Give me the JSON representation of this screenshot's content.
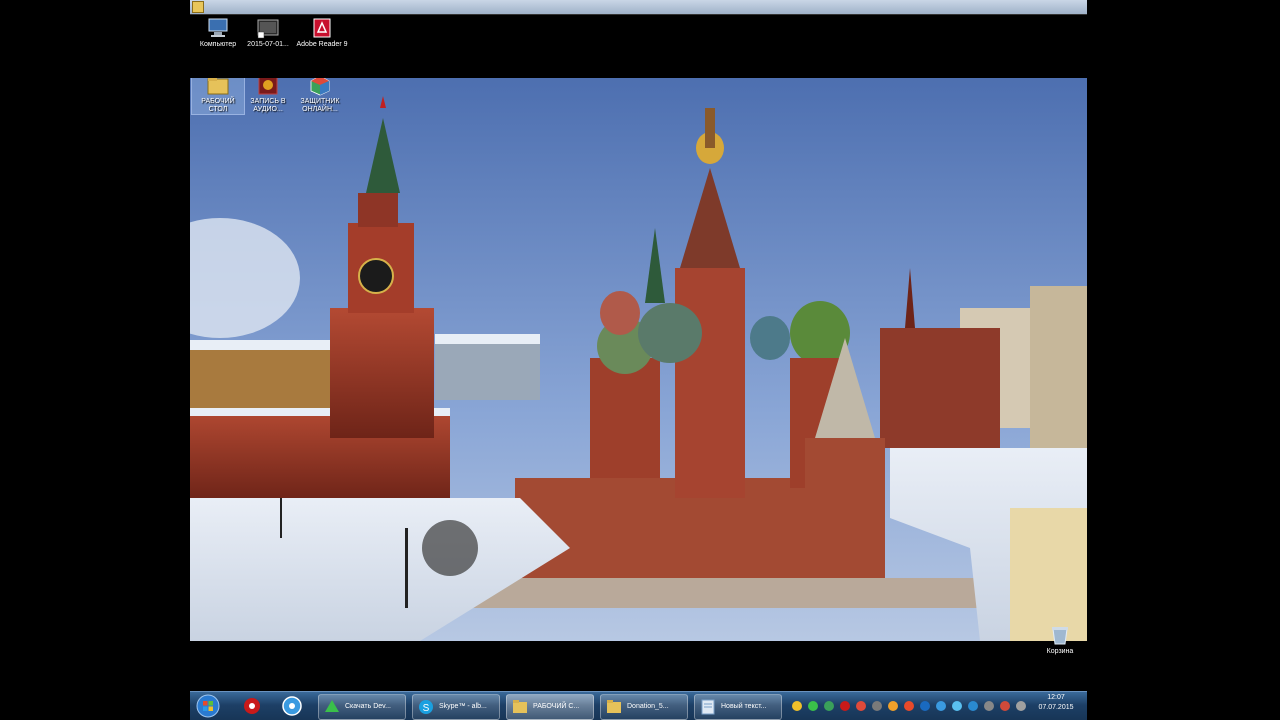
{
  "colors": {
    "taskbar": "#1d3f66",
    "sky": "#6f8fc4"
  },
  "top_icons": [
    {
      "icon": "computer-icon",
      "label": "Компьютер"
    },
    {
      "icon": "shortcut-icon",
      "label": "2015-07-01..."
    },
    {
      "icon": "adobe-reader-icon",
      "label": "Adobe Reader 9"
    }
  ],
  "desk_icons": [
    {
      "icon": "folder-icon",
      "label": "РАБОЧИЙ СТОЛ"
    },
    {
      "icon": "app-shortcut-icon",
      "label": "ЗАПИСЬ В АУДИО..."
    },
    {
      "icon": "cube-app-icon",
      "label": "ЗАЩИТНИК ОНЛАЙН..."
    }
  ],
  "recycle_label": "Корзина",
  "taskbar": {
    "buttons": [
      {
        "icon": "download-icon",
        "label": "Скачать Dev..."
      },
      {
        "icon": "skype-icon",
        "label": "Skype™ - alb..."
      },
      {
        "icon": "folder-icon",
        "label": "РАБОЧИЙ С..."
      },
      {
        "icon": "folder-icon",
        "label": "Donation_5..."
      },
      {
        "icon": "notepad-icon",
        "label": "Новый текст..."
      }
    ]
  },
  "clock": {
    "time": "12:07",
    "date": "07.07.2015"
  }
}
